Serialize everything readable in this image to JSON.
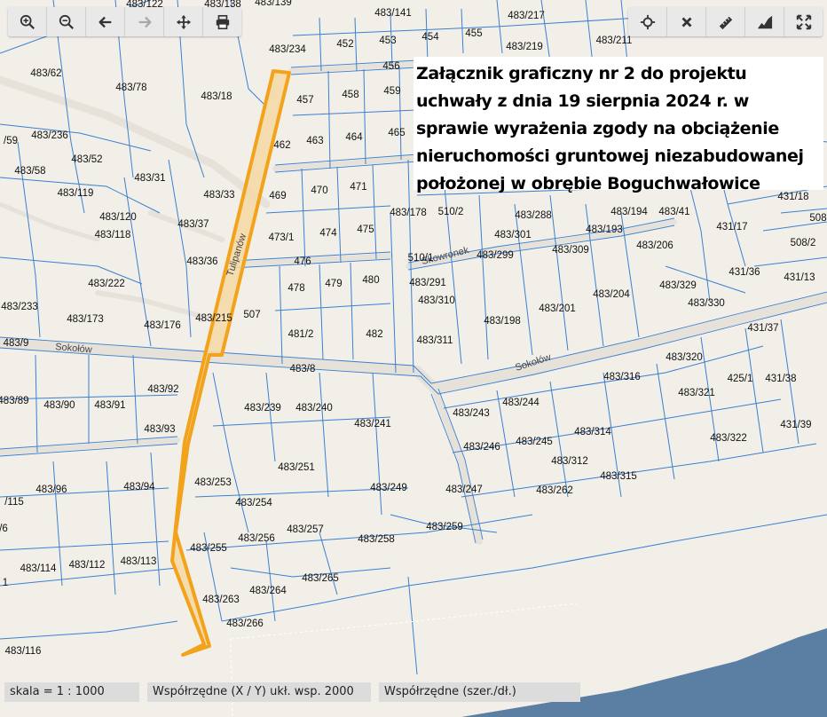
{
  "toolbar_left": [
    {
      "name": "zoom-in-icon",
      "title": "Powiększ"
    },
    {
      "name": "zoom-out-icon",
      "title": "Pomniejsz"
    },
    {
      "name": "arrow-back-icon",
      "title": "Wstecz"
    },
    {
      "name": "arrow-forward-icon",
      "title": "Dalej"
    },
    {
      "name": "pan-move-icon",
      "title": "Przesuń"
    },
    {
      "name": "print-icon",
      "title": "Drukuj"
    }
  ],
  "toolbar_right": [
    {
      "name": "locate-crosshair-icon",
      "title": "Lokalizuj"
    },
    {
      "name": "clear-close-icon",
      "title": "Wyczyść"
    },
    {
      "name": "measure-ruler-icon",
      "title": "Pomiar"
    },
    {
      "name": "profile-terrain-icon",
      "title": "Profil"
    },
    {
      "name": "fullscreen-icon",
      "title": "Pełny ekran"
    }
  ],
  "annotation": {
    "text": "Załącznik graficzny nr 2 do projektu uchwały z dnia 19 sierpnia 2024 r. w sprawie wyrażenia zgody na obciążenie nieruchomości gruntowej niezabudowanej położonej w obrębie Boguchwałowice"
  },
  "status": {
    "scale": "skala = 1 : 1000",
    "coords_xy": "Współrzędne (X / Y) ukł. wsp. 2000",
    "coords_geo": "Współrzędne (szer./dł.)"
  },
  "colors": {
    "background": "#f2efe9",
    "parcel_line": "#3b7fd0",
    "road_fill": "#e6e2da",
    "highlight": "#f2a31b",
    "water": "#5b7fa3"
  },
  "streets": [
    "Tulipanów",
    "Sokołów",
    "Sokołów",
    "Sokołów",
    "Skowronek"
  ],
  "parcel_labels": [
    "483/122",
    "483/138",
    "483/139",
    "483/141",
    "483/217",
    "483/219",
    "483/211",
    "483/234",
    "452",
    "453",
    "454",
    "455",
    "456",
    "483/62",
    "483/78",
    "483/18",
    "457",
    "458",
    "459",
    "/59",
    "483/236",
    "462",
    "463",
    "464",
    "465",
    "483/58",
    "483/52",
    "483/31",
    "483/33",
    "469",
    "470",
    "471",
    "483/119",
    "483/120",
    "483/118",
    "483/37",
    "473/1",
    "474",
    "475",
    "483/178",
    "510/2",
    "483/288",
    "483/301",
    "483/193",
    "483/194",
    "483/41",
    "431/18",
    "431/17",
    "508/2",
    "483/206",
    "483/36",
    "476",
    "510/1",
    "483/299",
    "483/309",
    "431/36",
    "431/13",
    "483/222",
    "478",
    "479",
    "480",
    "483/291",
    "483/204",
    "483/329",
    "483/233",
    "483/173",
    "483/176",
    "483/215",
    "507",
    "483/310",
    "483/330",
    "483/201",
    "483/198",
    "431/37",
    "481/2",
    "482",
    "483/311",
    "483/9",
    "483/8",
    "483/320",
    "425/1",
    "431/38",
    "483/92",
    "483/316",
    "483/321",
    "483/89",
    "483/90",
    "483/91",
    "483/239",
    "483/240",
    "483/243",
    "483/244",
    "483/93",
    "483/241",
    "483/314",
    "431/39",
    "483/322",
    "483/245",
    "483/246",
    "483/251",
    "483/312",
    "483/96",
    "483/94",
    "483/253",
    "483/249",
    "483/247",
    "483/315",
    "483/262",
    "/115",
    "483/254",
    "483/257",
    "483/259",
    "483/256",
    "483/258",
    "483/255",
    "483/114",
    "483/112",
    "483/113",
    "483/264",
    "483/265",
    "483/263",
    "483/266",
    "483/116",
    "1",
    "/6",
    "508"
  ]
}
